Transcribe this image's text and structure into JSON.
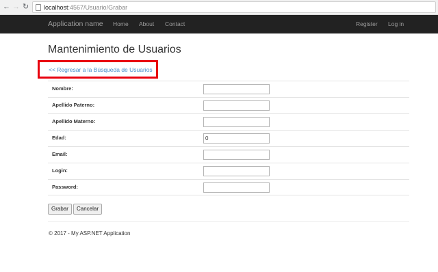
{
  "browser": {
    "back_icon": "←",
    "forward_icon": "→",
    "reload_icon": "↻",
    "url_host": "localhost",
    "url_path": ":4567/Usuario/Grabar"
  },
  "navbar": {
    "brand": "Application name",
    "links": [
      "Home",
      "About",
      "Contact"
    ],
    "register": "Register",
    "login": "Log in"
  },
  "page": {
    "title": "Mantenimiento de Usuarios",
    "back_link": "<< Regresar a la Búsqueda de Usuarios",
    "highlight_color": "#e8000d"
  },
  "form": {
    "fields": [
      {
        "label": "Nombre:",
        "value": ""
      },
      {
        "label": "Apellido Paterno:",
        "value": ""
      },
      {
        "label": "Apellido Materno:",
        "value": ""
      },
      {
        "label": "Edad:",
        "value": "0"
      },
      {
        "label": "Email:",
        "value": ""
      },
      {
        "label": "Login:",
        "value": ""
      },
      {
        "label": "Password:",
        "value": ""
      }
    ],
    "save_label": "Grabar",
    "cancel_label": "Cancelar"
  },
  "footer": {
    "text": "© 2017 - My ASP.NET Application"
  }
}
